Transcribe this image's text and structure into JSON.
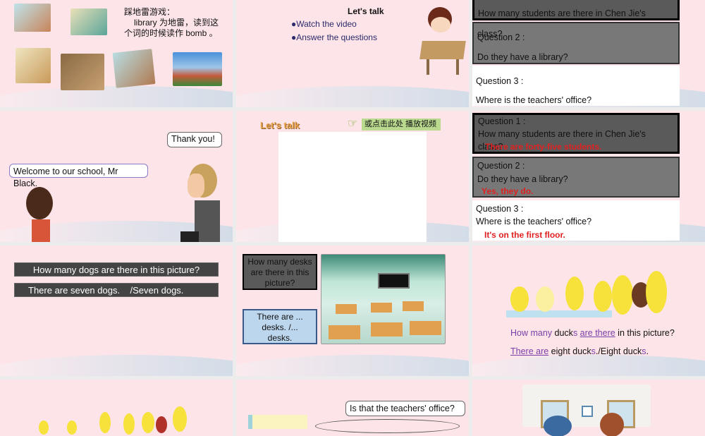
{
  "slides": {
    "s1": {
      "title": "踩地雷游戏：",
      "line2": "library 为地雷，读到这",
      "line3": "个词的时候读作 bomb 。"
    },
    "s2": {
      "title": "Let's talk",
      "bullets": [
        "●Watch the video",
        "●Answer the questions"
      ]
    },
    "s3": {
      "q1_text": "How many students are there in Chen Jie's",
      "q1_overflow": "class?",
      "q2_label": "Question 2 :",
      "q2_text": "Do they have a library?",
      "q3_label": "Question 3 :",
      "q3_text": "Where is the teachers' office?"
    },
    "s4": {
      "bubble_man": "Thank you!",
      "bubble_girl": "Welcome to our school, Mr Black."
    },
    "s5": {
      "title": "Let's talk",
      "video_link": "或点击此处 播放视频"
    },
    "s6": {
      "q1_label": "Question 1 :",
      "q1_text": "How many students are there in Chen Jie's",
      "q1_overflow": "class?",
      "a1": "There are forty-five students.",
      "q2_label": "Question 2 :",
      "q2_text": "Do they have a library?",
      "a2": "Yes, they do.",
      "q3_label": "Question 3 :",
      "q3_text": "Where is the teachers' office?",
      "a3": "It's on the first floor."
    },
    "s7": {
      "question": "How many dogs are there in this picture?",
      "answer": "There are seven dogs.    /Seven dogs."
    },
    "s8": {
      "question": "How many desks are there in this picture?",
      "answer": "There are ... desks. /... desks."
    },
    "s9": {
      "q_how": "How many",
      "q_ducks": " duck",
      "q_s": "s",
      "q_space": " ",
      "q_are": "are there",
      "q_rest": " in this picture?",
      "a_there": "There are",
      "a_rest": " eight duck",
      "a_s": "s",
      "a_mid": "./Eight duck",
      "a_s2": "s",
      "a_end": "."
    },
    "s11": {
      "bubble": "Is that the teachers' office?"
    }
  },
  "colors": {
    "slide_bg": "#fde4e8",
    "purple": "#7a3fa8",
    "answer_red": "#e02020"
  }
}
